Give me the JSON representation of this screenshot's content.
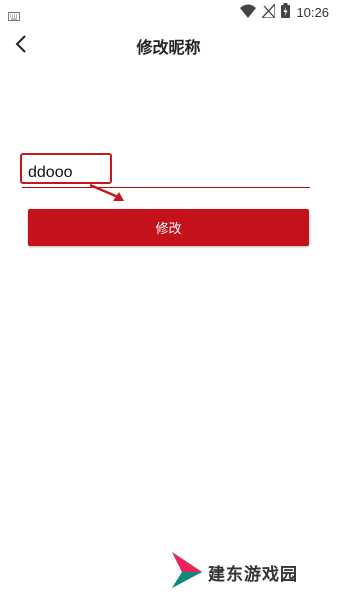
{
  "status_bar": {
    "time": "10:26",
    "icons": [
      "keyboard-icon",
      "wifi-icon",
      "no-signal-icon",
      "battery-charging-icon"
    ]
  },
  "header": {
    "title": "修改昵称",
    "back_icon": "chevron-left-icon"
  },
  "form": {
    "nickname_value": "ddooo",
    "submit_label": "修改"
  },
  "watermark": {
    "text": "建东游戏园"
  },
  "colors": {
    "accent": "#c5111a",
    "highlight": "#c8181e"
  }
}
